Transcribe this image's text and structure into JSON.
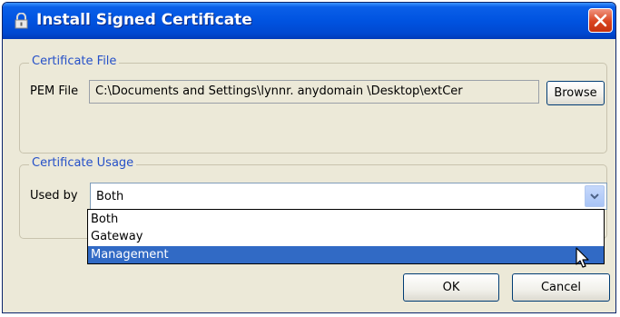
{
  "window": {
    "title": "Install Signed Certificate"
  },
  "certificate_file": {
    "legend": "Certificate File",
    "pem_label": "PEM File",
    "pem_value": "C:\\Documents and Settings\\lynnr. anydomain \\Desktop\\extCer",
    "browse_label": "Browse"
  },
  "certificate_usage": {
    "legend": "Certificate Usage",
    "used_by_label": "Used by",
    "selected_value": "Both",
    "options": [
      "Both",
      "Gateway",
      "Management"
    ],
    "highlighted_option": "Management"
  },
  "buttons": {
    "ok": "OK",
    "cancel": "Cancel"
  },
  "colors": {
    "titlebar": "#0053e0",
    "legend_text": "#2550c8",
    "highlight": "#316ac5",
    "dialog_bg": "#ece9d8"
  }
}
